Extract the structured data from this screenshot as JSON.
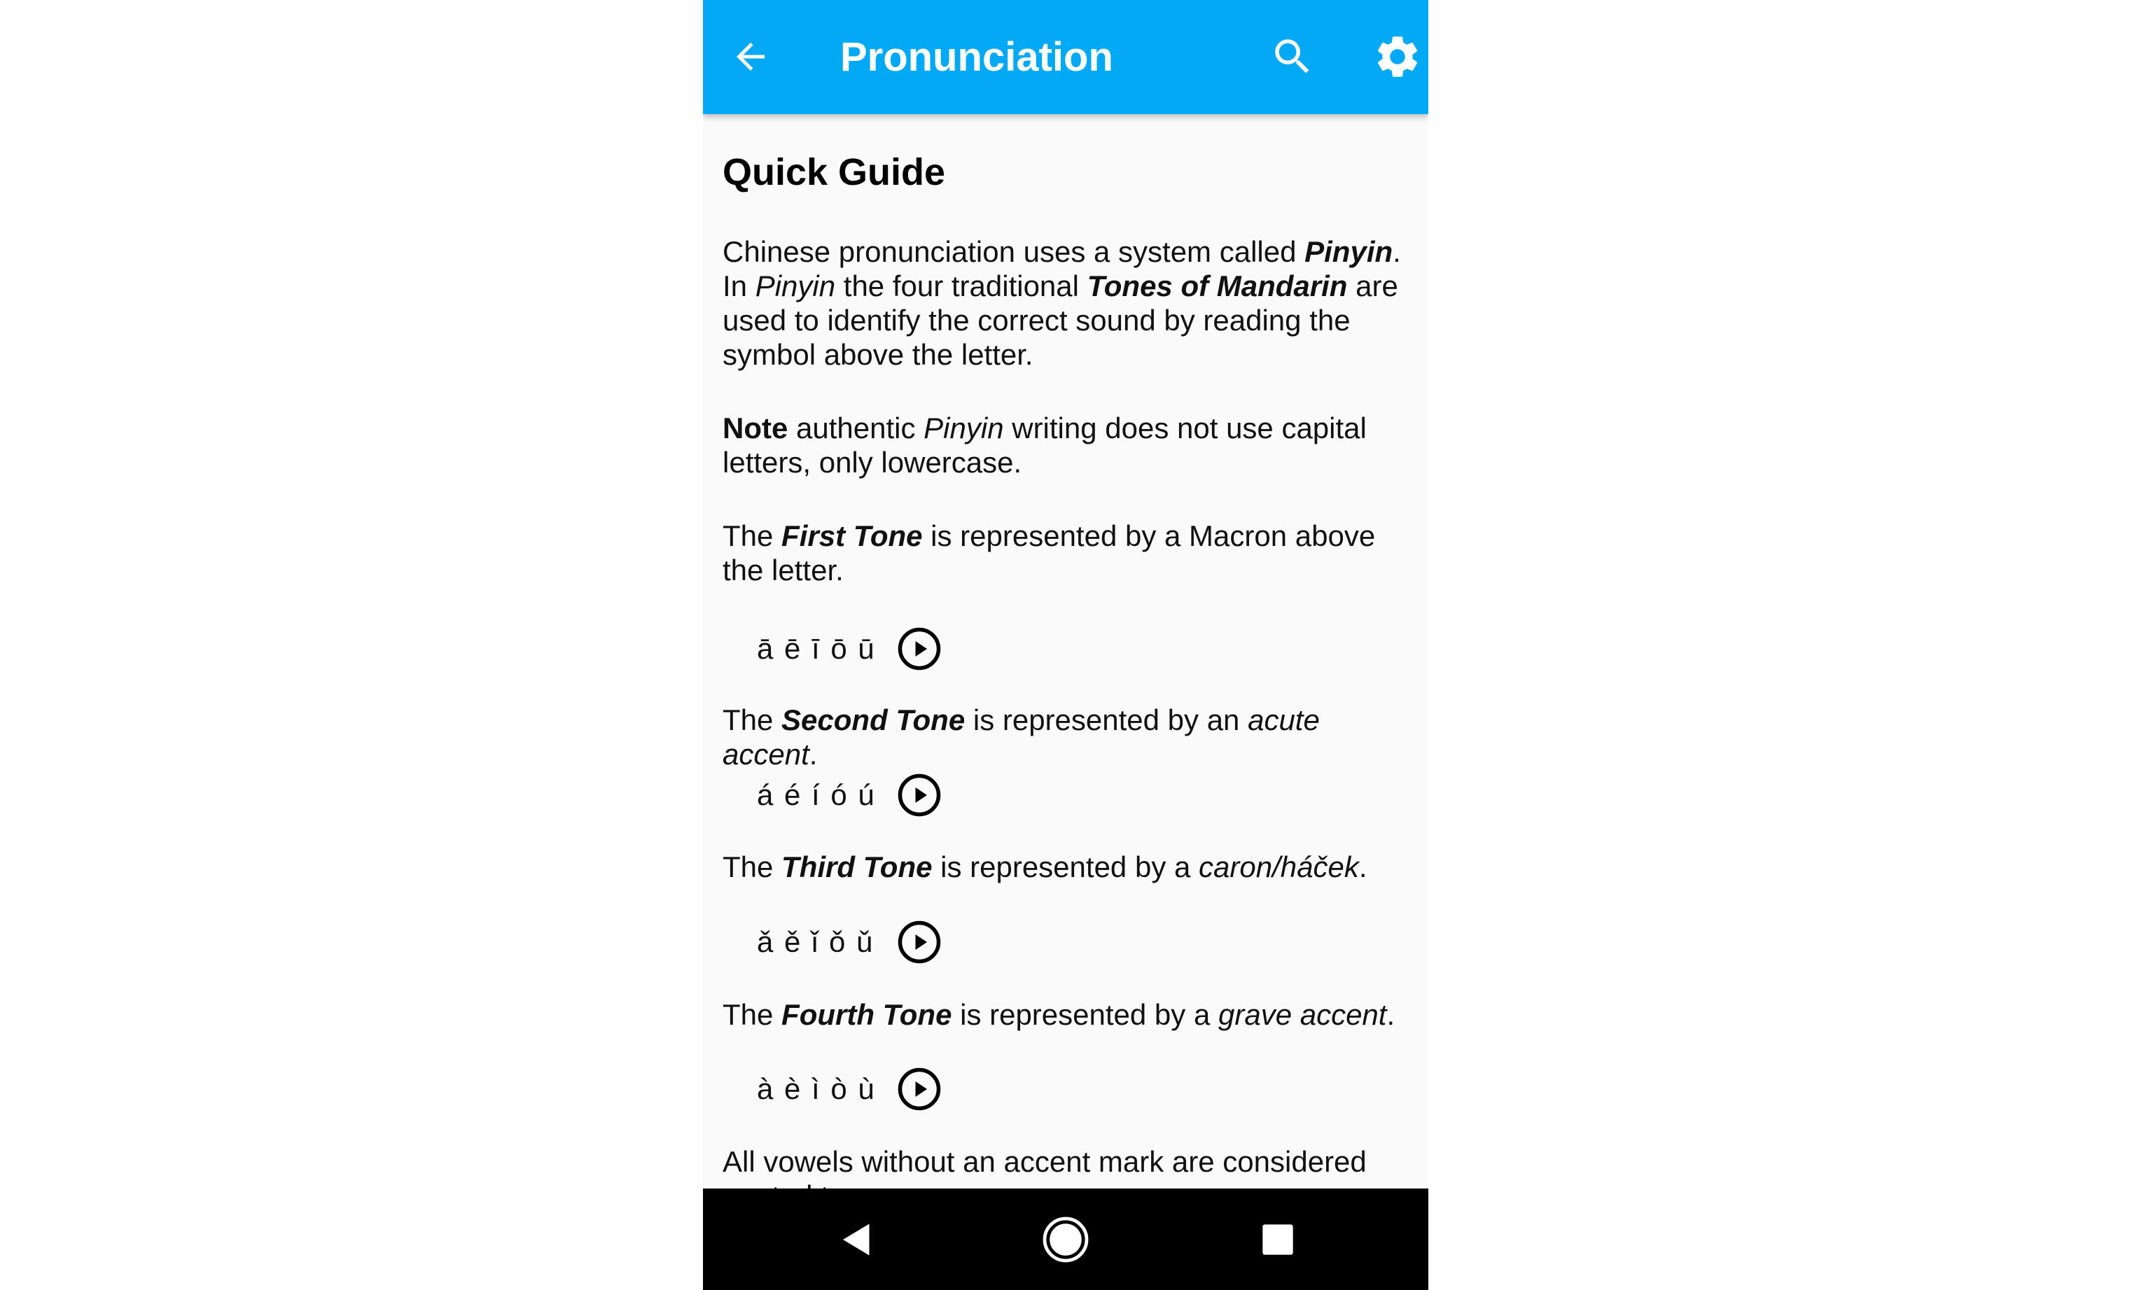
{
  "appbar": {
    "title": "Pronunciation",
    "back_icon": "arrow-left-icon",
    "search_icon": "search-icon",
    "settings_icon": "gear-icon",
    "color": "#03a9f4"
  },
  "guide": {
    "heading": "Quick Guide",
    "intro": {
      "s1": "Chinese pronunciation uses a system called ",
      "pinyin1": "Pinyin",
      "s2": ". In ",
      "pinyin2": "Pinyin",
      "s3": " the four traditional ",
      "tones_of_mandarin": "Tones of Mandarin",
      "s4": " are used to identify the correct sound by reading the symbol above the letter."
    },
    "note": {
      "label": "Note",
      "s1": " authentic ",
      "pinyin": "Pinyin",
      "s2": " writing does not use capital letters, only lowercase."
    },
    "tones": [
      {
        "prefix": "The ",
        "name": "First Tone",
        "middle": " is represented by a Macron above the letter.",
        "mark": "",
        "suffix": "",
        "vowels": "ā ē ī ō ū"
      },
      {
        "prefix": "The ",
        "name": "Second Tone",
        "middle": " is represented by an ",
        "mark": "acute accent",
        "suffix": ".",
        "vowels": "á é í ó ú"
      },
      {
        "prefix": "The ",
        "name": "Third Tone",
        "middle": " is represented by a ",
        "mark": "caron/háček",
        "suffix": ".",
        "vowels": "ǎ ě ǐ ǒ ǔ"
      },
      {
        "prefix": "The ",
        "name": "Fourth Tone",
        "middle": " is represented by a ",
        "mark": "grave accent",
        "suffix": ".",
        "vowels": "à è ì ò ù"
      }
    ],
    "play_icon": "play-circle-icon",
    "closing": "All vowels without an accent mark are considered neutral tones."
  },
  "navbar": {
    "back_icon": "nav-back-icon",
    "home_icon": "nav-home-icon",
    "recents_icon": "nav-recents-icon"
  }
}
